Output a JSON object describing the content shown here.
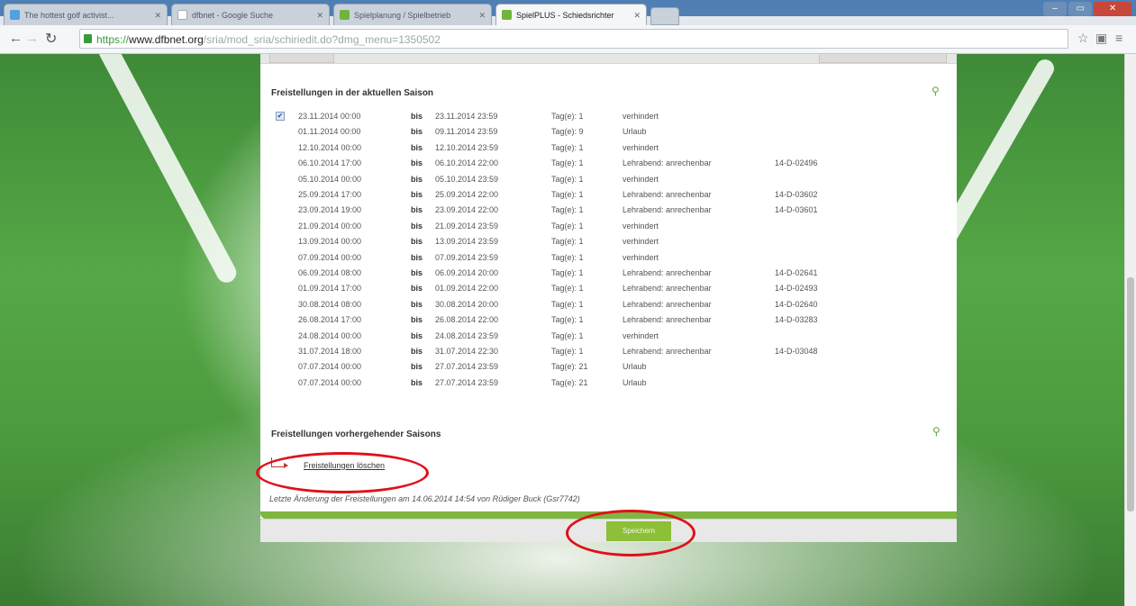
{
  "browser": {
    "tabs": [
      {
        "label": "The hottest golf activist..."
      },
      {
        "label": "dfbnet - Google Suche"
      },
      {
        "label": "Spielplanung / Spielbetrieb"
      },
      {
        "label": "SpielPLUS - Schiedsrichter"
      }
    ],
    "url_protocol": "https://",
    "url_host": "www.dfbnet.org",
    "url_path": "/sria/mod_sria/schiriedit.do?dmg_menu=1350502"
  },
  "current_season": {
    "title": "Freistellungen in der aktuellen Saison",
    "rows": [
      {
        "from": "23.11.2014 00:00",
        "bis": "bis",
        "to": "23.11.2014 23:59",
        "days": "Tag(e): 1",
        "reason": "verhindert",
        "ref": "",
        "checked": true
      },
      {
        "from": "01.11.2014 00:00",
        "bis": "bis",
        "to": "09.11.2014 23:59",
        "days": "Tag(e): 9",
        "reason": "Urlaub",
        "ref": ""
      },
      {
        "from": "12.10.2014 00:00",
        "bis": "bis",
        "to": "12.10.2014 23:59",
        "days": "Tag(e): 1",
        "reason": "verhindert",
        "ref": ""
      },
      {
        "from": "06.10.2014 17:00",
        "bis": "bis",
        "to": "06.10.2014 22:00",
        "days": "Tag(e): 1",
        "reason": "Lehrabend: anrechenbar",
        "ref": "14-D-02496"
      },
      {
        "from": "05.10.2014 00:00",
        "bis": "bis",
        "to": "05.10.2014 23:59",
        "days": "Tag(e): 1",
        "reason": "verhindert",
        "ref": ""
      },
      {
        "from": "25.09.2014 17:00",
        "bis": "bis",
        "to": "25.09.2014 22:00",
        "days": "Tag(e): 1",
        "reason": "Lehrabend: anrechenbar",
        "ref": "14-D-03602"
      },
      {
        "from": "23.09.2014 19:00",
        "bis": "bis",
        "to": "23.09.2014 22:00",
        "days": "Tag(e): 1",
        "reason": "Lehrabend: anrechenbar",
        "ref": "14-D-03601"
      },
      {
        "from": "21.09.2014 00:00",
        "bis": "bis",
        "to": "21.09.2014 23:59",
        "days": "Tag(e): 1",
        "reason": "verhindert",
        "ref": ""
      },
      {
        "from": "13.09.2014 00:00",
        "bis": "bis",
        "to": "13.09.2014 23:59",
        "days": "Tag(e): 1",
        "reason": "verhindert",
        "ref": ""
      },
      {
        "from": "07.09.2014 00:00",
        "bis": "bis",
        "to": "07.09.2014 23:59",
        "days": "Tag(e): 1",
        "reason": "verhindert",
        "ref": ""
      },
      {
        "from": "06.09.2014 08:00",
        "bis": "bis",
        "to": "06.09.2014 20:00",
        "days": "Tag(e): 1",
        "reason": "Lehrabend: anrechenbar",
        "ref": "14-D-02641"
      },
      {
        "from": "01.09.2014 17:00",
        "bis": "bis",
        "to": "01.09.2014 22:00",
        "days": "Tag(e): 1",
        "reason": "Lehrabend: anrechenbar",
        "ref": "14-D-02493"
      },
      {
        "from": "30.08.2014 08:00",
        "bis": "bis",
        "to": "30.08.2014 20:00",
        "days": "Tag(e): 1",
        "reason": "Lehrabend: anrechenbar",
        "ref": "14-D-02640"
      },
      {
        "from": "26.08.2014 17:00",
        "bis": "bis",
        "to": "26.08.2014 22:00",
        "days": "Tag(e): 1",
        "reason": "Lehrabend: anrechenbar",
        "ref": "14-D-03283"
      },
      {
        "from": "24.08.2014 00:00",
        "bis": "bis",
        "to": "24.08.2014 23:59",
        "days": "Tag(e): 1",
        "reason": "verhindert",
        "ref": ""
      },
      {
        "from": "31.07.2014 18:00",
        "bis": "bis",
        "to": "31.07.2014 22:30",
        "days": "Tag(e): 1",
        "reason": "Lehrabend: anrechenbar",
        "ref": "14-D-03048"
      },
      {
        "from": "07.07.2014 00:00",
        "bis": "bis",
        "to": "27.07.2014 23:59",
        "days": "Tag(e): 21",
        "reason": "Urlaub",
        "ref": ""
      },
      {
        "from": "07.07.2014 00:00",
        "bis": "bis",
        "to": "27.07.2014 23:59",
        "days": "Tag(e): 21",
        "reason": "Urlaub",
        "ref": ""
      }
    ]
  },
  "previous_seasons": {
    "title": "Freistellungen vorhergehender Saisons"
  },
  "delete_link": "Freistellungen löschen",
  "last_change": "Letzte Änderung der Freistellungen am 14.06.2014 14:54 von Rüdiger Buck (Gsr7742)",
  "save_button": "Speichern",
  "colors": {
    "accent_green": "#8dbf38",
    "annotation_red": "#e0101a"
  }
}
